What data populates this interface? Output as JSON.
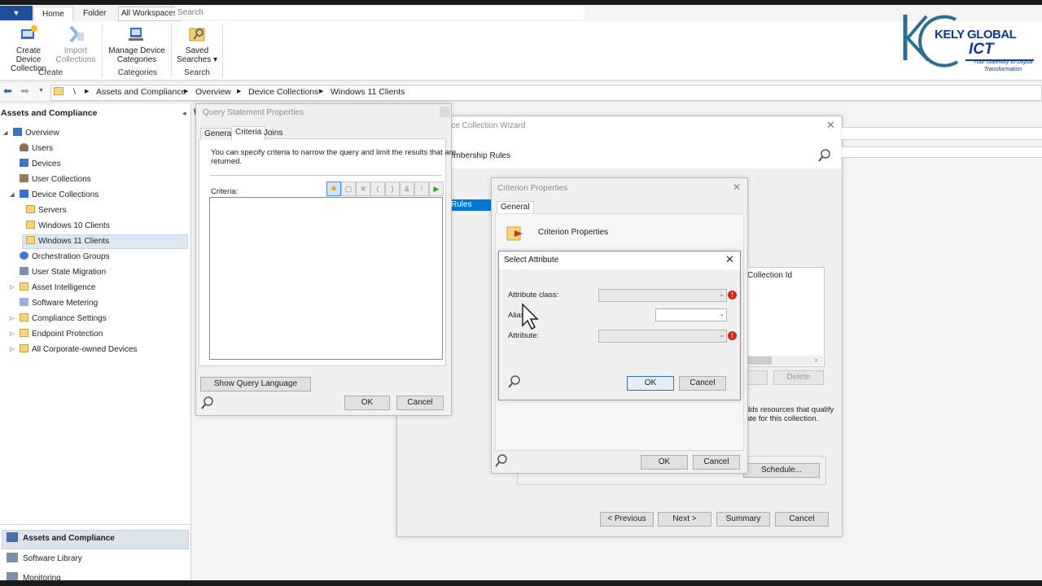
{
  "ribbon": {
    "app_menu": "▼",
    "tabs": [
      "Home",
      "Folder"
    ],
    "workspace_label": "All Workspaces",
    "search_placeholder": "Search",
    "buttons": {
      "create_device_collection": [
        "Create Device",
        "Collection"
      ],
      "import_collections": [
        "Import",
        "Collections"
      ],
      "manage_device_categories": [
        "Manage Device",
        "Categories"
      ],
      "saved_searches": [
        "Saved",
        "Searches ▾"
      ]
    },
    "groups": {
      "create": "Create",
      "categories": "Categories",
      "search": "Search"
    }
  },
  "breadcrumb": [
    "\\",
    "Assets and Compliance",
    "Overview",
    "Device Collections",
    "Windows 11 Clients"
  ],
  "left_pane": {
    "title": "Assets and Compliance",
    "tree": [
      {
        "label": "Overview",
        "level": 0,
        "icon": "overview-icon"
      },
      {
        "label": "Users",
        "level": 1,
        "icon": "user-icon"
      },
      {
        "label": "Devices",
        "level": 1,
        "icon": "device-icon"
      },
      {
        "label": "User Collections",
        "level": 1,
        "icon": "user-collections-icon"
      },
      {
        "label": "Device Collections",
        "level": 0,
        "icon": "device-collections-icon"
      },
      {
        "label": "Servers",
        "level": 1,
        "icon": "folder-icon"
      },
      {
        "label": "Windows 10 Clients",
        "level": 1,
        "icon": "folder-icon"
      },
      {
        "label": "Windows 11 Clients",
        "level": 1,
        "icon": "folder-icon"
      },
      {
        "label": "Orchestration Groups",
        "level": 1,
        "icon": "orchestration-icon"
      },
      {
        "label": "User State Migration",
        "level": 1,
        "icon": "migration-icon"
      },
      {
        "label": "Asset Intelligence",
        "level": 1,
        "icon": "folder-icon"
      },
      {
        "label": "Software Metering",
        "level": 1,
        "icon": "metering-icon"
      },
      {
        "label": "Compliance Settings",
        "level": 1,
        "icon": "folder-icon"
      },
      {
        "label": "Endpoint Protection",
        "level": 1,
        "icon": "folder-icon"
      },
      {
        "label": "All Corporate-owned Devices",
        "level": 1,
        "icon": "folder-icon"
      }
    ],
    "workspaces": [
      "Assets and Compliance",
      "Software Library",
      "Monitoring"
    ]
  },
  "logo": {
    "line1": "KELY GLOBAL",
    "line2": "ICT",
    "tagline": [
      "Your Gateway to Digital",
      "Transformation"
    ]
  },
  "query_dialog": {
    "title": "Query Statement Properties",
    "tabs": [
      "General",
      "Criteria",
      "Joins"
    ],
    "active_tab": "Criteria",
    "description": [
      "You can specify criteria to narrow the query and limit the results that are",
      "returned."
    ],
    "criteria_label": "Criteria:",
    "show_query_language": "Show Query Language",
    "ok": "OK",
    "cancel": "Cancel"
  },
  "wizard": {
    "title": "ice Collection Wizard",
    "heading": "embership Rules",
    "rules_label": "Rules",
    "collection_id": "Collection Id",
    "delete": "Delete",
    "description": [
      "dds resources that qualify",
      "ate for this collection."
    ],
    "schedule": "Schedule...",
    "previous": "< Previous",
    "next": "Next >",
    "summary": "Summary",
    "cancel": "Cancel"
  },
  "criterion_dialog": {
    "title": "Criterion Properties",
    "tab": "General",
    "heading": "Criterion Properties",
    "ok": "OK",
    "cancel": "Cancel"
  },
  "select_attribute": {
    "title": "Select Attribute",
    "attribute_class_label": "Attribute class:",
    "alias_label": "Alias",
    "attribute_label": "Attribute:",
    "ok": "OK",
    "cancel": "Cancel"
  }
}
